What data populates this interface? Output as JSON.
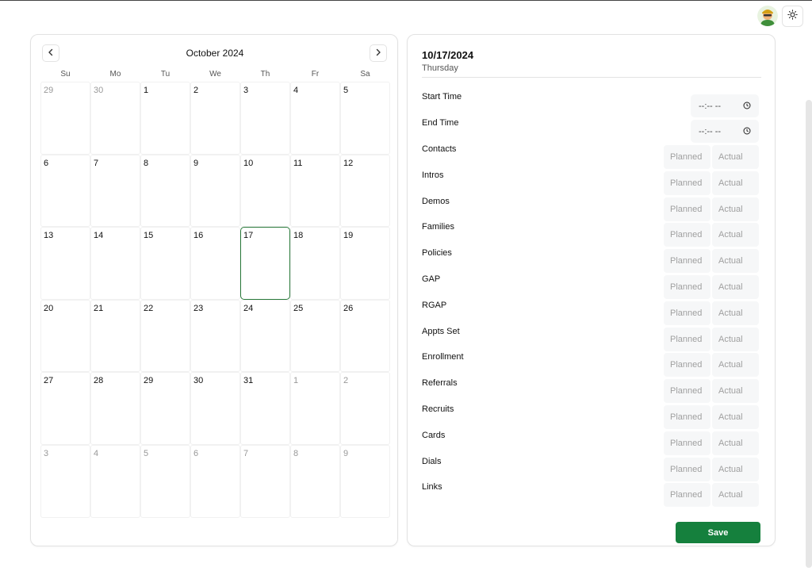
{
  "calendar": {
    "month_title": "October 2024",
    "weekdays": [
      "Su",
      "Mo",
      "Tu",
      "We",
      "Th",
      "Fr",
      "Sa"
    ],
    "days": [
      {
        "label": "29",
        "muted": true
      },
      {
        "label": "30",
        "muted": true
      },
      {
        "label": "1"
      },
      {
        "label": "2"
      },
      {
        "label": "3"
      },
      {
        "label": "4"
      },
      {
        "label": "5"
      },
      {
        "label": "6"
      },
      {
        "label": "7"
      },
      {
        "label": "8"
      },
      {
        "label": "9"
      },
      {
        "label": "10"
      },
      {
        "label": "11"
      },
      {
        "label": "12"
      },
      {
        "label": "13"
      },
      {
        "label": "14"
      },
      {
        "label": "15"
      },
      {
        "label": "16"
      },
      {
        "label": "17",
        "selected": true
      },
      {
        "label": "18"
      },
      {
        "label": "19"
      },
      {
        "label": "20"
      },
      {
        "label": "21"
      },
      {
        "label": "22"
      },
      {
        "label": "23"
      },
      {
        "label": "24"
      },
      {
        "label": "25"
      },
      {
        "label": "26"
      },
      {
        "label": "27"
      },
      {
        "label": "28"
      },
      {
        "label": "29"
      },
      {
        "label": "30"
      },
      {
        "label": "31"
      },
      {
        "label": "1",
        "muted": true
      },
      {
        "label": "2",
        "muted": true
      },
      {
        "label": "3",
        "muted": true
      },
      {
        "label": "4",
        "muted": true
      },
      {
        "label": "5",
        "muted": true
      },
      {
        "label": "6",
        "muted": true
      },
      {
        "label": "7",
        "muted": true
      },
      {
        "label": "8",
        "muted": true
      },
      {
        "label": "9",
        "muted": true
      }
    ]
  },
  "detail": {
    "date": "10/17/2024",
    "weekday": "Thursday",
    "start_time_label": "Start Time",
    "end_time_label": "End Time",
    "time_placeholder": "--:-- --",
    "planned_placeholder": "Planned",
    "actual_placeholder": "Actual",
    "metrics": [
      "Contacts",
      "Intros",
      "Demos",
      "Families",
      "Policies",
      "GAP",
      "RGAP",
      "Appts Set",
      "Enrollment",
      "Referrals",
      "Recruits",
      "Cards",
      "Dials",
      "Links"
    ],
    "save_label": "Save"
  },
  "colors": {
    "accent": "#15803d",
    "selected_border": "#2a7a3b"
  },
  "icons": {
    "prev": "chevron-left-icon",
    "next": "chevron-right-icon",
    "theme": "sun-icon",
    "clock": "clock-icon",
    "avatar": "user-avatar"
  }
}
